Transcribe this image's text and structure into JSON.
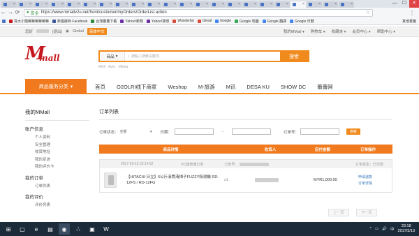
{
  "browser": {
    "window_controls": [
      "—",
      "☐",
      "✕"
    ],
    "nav_icons": [
      "←",
      "→",
      "⟳"
    ],
    "secure_label": "安全",
    "url": "https://www.mmallv2u.net/front/customer/myOrders/OrderList.action",
    "bookmarks": [
      {
        "label": "",
        "color": "#4a72c4"
      },
      {
        "label": "買大小隨嘛嘛嘛嘛嘛嘛",
        "color": "#c6161d"
      },
      {
        "label": "新祖將到 Facebook",
        "color": "#3b5998"
      },
      {
        "label": "台灣蕃薯下載",
        "color": "#2e8b3a"
      },
      {
        "label": "Yahoo!新聞",
        "color": "#6b2fa3"
      },
      {
        "label": "Yahoo!搜尋",
        "color": "#6b2fa3"
      },
      {
        "label": "Wunderlist",
        "color": "#d94a38"
      },
      {
        "label": "Gmail",
        "color": "#d94a38"
      },
      {
        "label": "Google",
        "color": "#4285f4"
      },
      {
        "label": "Google 地圖",
        "color": "#34a853"
      },
      {
        "label": "Google 翻譯",
        "color": "#4285f4"
      },
      {
        "label": "Google 日曆",
        "color": "#4285f4"
      }
    ],
    "bookmarks_other": "其他書籤"
  },
  "topbar": {
    "greeting": "您好",
    "logout": "[退出]",
    "global": "Global",
    "lang": "简体中文",
    "links": [
      "我的MMall ▾",
      "购物车 ▾",
      "收藏夹 ▾",
      "会员中心 ▾",
      "帮助中心 ▾"
    ]
  },
  "header": {
    "logo_m": "M",
    "logo_mall": "mall",
    "search_category": "商品",
    "search_placeholder": "請輸入搜索关键词",
    "search_button": "搜索",
    "hot_words": "MiNi · Aver · Midea"
  },
  "nav": {
    "category_button": "商品服务分类",
    "links": [
      "首页",
      "O2OLRI线下商家",
      "Weshop",
      "M-旅游",
      "M讯",
      "DESA KU",
      "SHOW DC",
      "蕾蕾网"
    ]
  },
  "sidebar": {
    "title": "我的MMall",
    "groups": [
      {
        "title": "账户信息",
        "items": [
          "个人资料",
          "安全管理",
          "收货地址",
          "我的足迹",
          "我的评价卡"
        ]
      },
      {
        "title": "我的订单",
        "items": [
          "订单列表"
        ]
      },
      {
        "title": "我的评价",
        "items": [
          "评价列表"
        ]
      }
    ]
  },
  "orders": {
    "title": "订单列表",
    "filters": {
      "status_label": "订单状态：",
      "status_value": "全部",
      "date_label": "日期：",
      "date_sep": "-",
      "number_label": "订单号：",
      "search_button": "搜索"
    },
    "columns": [
      "商品详情",
      "收货人",
      "应付金额",
      "订单操作"
    ],
    "list": [
      {
        "datetime": "2017-03-13 23:14:52",
        "type": "PC端普通订单",
        "number_label": "订单号：",
        "status": "订单状态：已付款",
        "product": "【HITACHI 日立】6公斤滾筒清掃子FUZZY除濕機 RD-12FS / RD-12FG",
        "qty": "x1",
        "price": "MYR1,000.00",
        "actions": [
          "申请退款",
          "订单详情"
        ]
      }
    ],
    "pager": [
      "上一页",
      "下一页"
    ]
  },
  "taskbar": {
    "apps": [
      "⊞",
      "▢",
      "e",
      "▤",
      "◉",
      "⛬",
      "▣",
      "W"
    ],
    "tray_icons": [
      "^",
      "▭",
      "🔊",
      "中"
    ],
    "time": "23:18",
    "date": "2017/3/13"
  },
  "colors": {
    "accent": "#f08a1d",
    "brand_red": "#c6161d",
    "link": "#2a6fb8"
  }
}
